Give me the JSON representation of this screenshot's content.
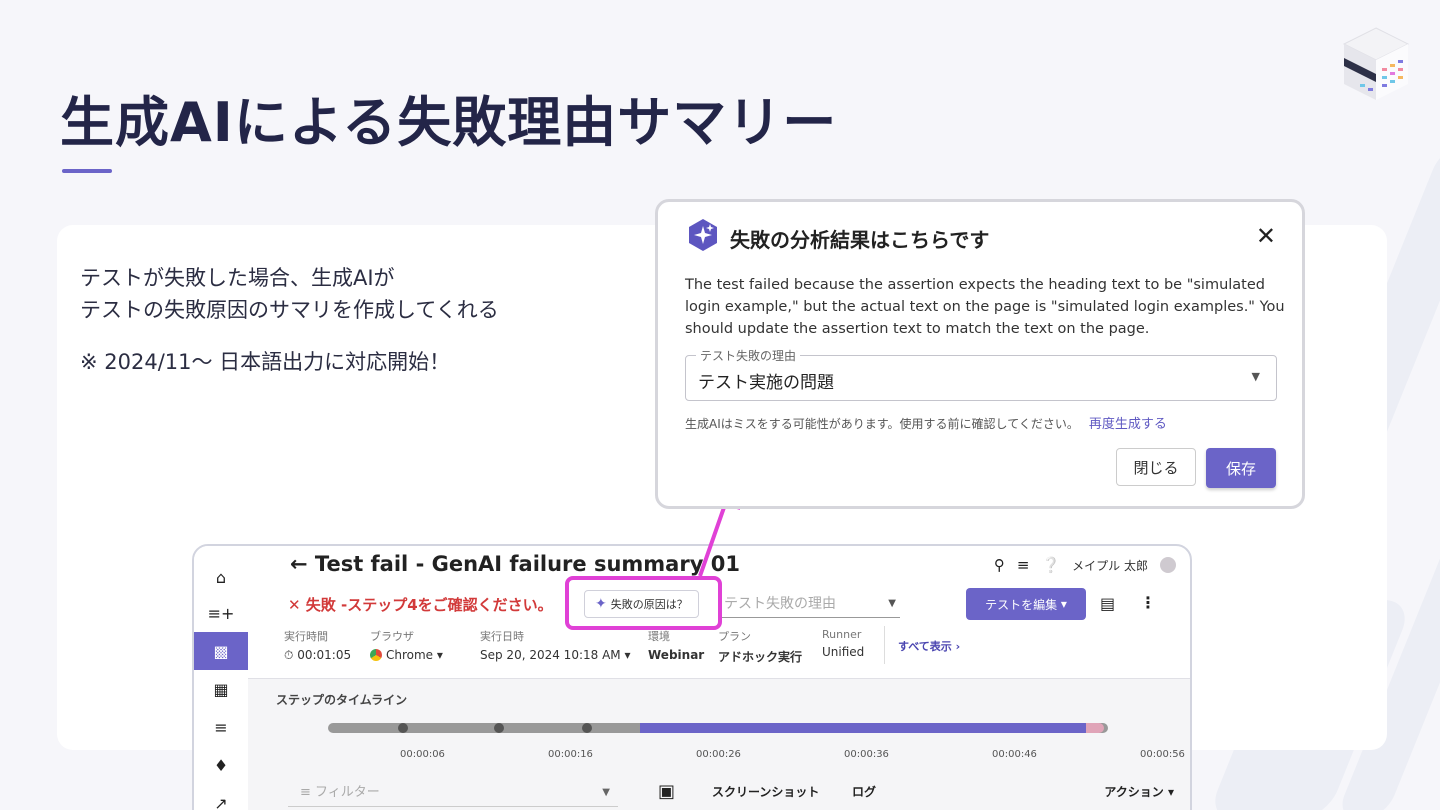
{
  "slide": {
    "title": "生成AIによる失敗理由サマリー",
    "desc_line1": "テストが失敗した場合、生成AIが",
    "desc_line2": "テストの失敗原因のサマリを作成してくれる",
    "note": "※ 2024/11〜 日本語出力に対応開始！",
    "accent_color": "#6b64c8",
    "highlight_color": "#e041d6"
  },
  "dialog": {
    "title": "失敗の分析結果はこちらです",
    "body": "The test failed because the assertion expects the heading text to be \"simulated login example,\" but the actual text on the page is \"simulated login examples.\" You should update the assertion text to match the text on the page.",
    "field_label": "テスト失敗の理由",
    "field_value": "テスト実施の問題",
    "note": "生成AIはミスをする可能性があります。使用する前に確認してください。",
    "regenerate": "再度生成する",
    "close_label": "閉じる",
    "save_label": "保存"
  },
  "app": {
    "title": "Test fail - GenAI failure summary 01",
    "user": "メイプル 太郎",
    "fail_status": "✕ 失敗 -ステップ4をご確認ください。",
    "why_button": "失敗の原因は？",
    "reason_placeholder": "テスト失敗の理由",
    "edit_button": "テストを編集",
    "meta": {
      "exec_time_label": "実行時間",
      "exec_time": "00:01:05",
      "browser_label": "ブラウザ",
      "browser": "Chrome",
      "date_label": "実行日時",
      "date": "Sep 20, 2024 10:18 AM",
      "env_label": "環境",
      "env": "Webinar",
      "plan_label": "プラン",
      "plan": "アドホック実行",
      "runner_label": "Runner",
      "runner": "Unified",
      "view_all": "すべて表示 ›"
    },
    "timeline": {
      "label": "ステップのタイムライン",
      "ticks": [
        "00:00:06",
        "00:00:16",
        "00:00:26",
        "00:00:36",
        "00:00:46",
        "00:00:56"
      ]
    },
    "filter_placeholder": "フィルター",
    "tabs": [
      "スクリーンショット",
      "ログ"
    ],
    "action": "アクション"
  }
}
